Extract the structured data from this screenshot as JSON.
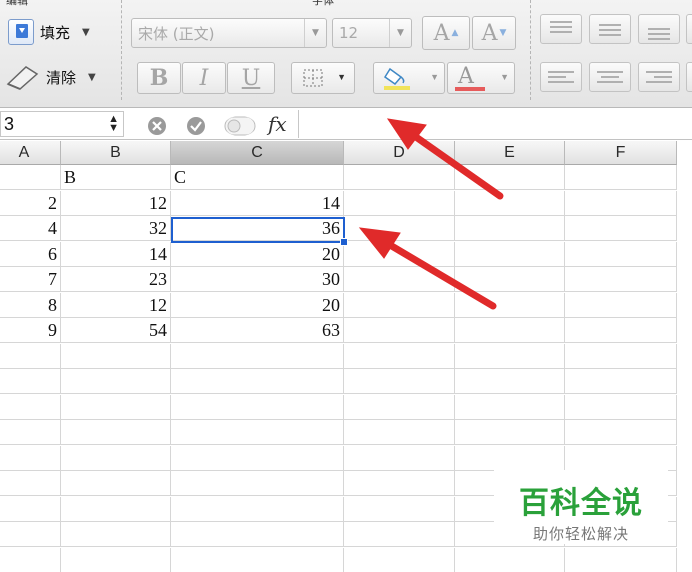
{
  "ribbon": {
    "group_edit_title": "编辑",
    "group_font_title": "字体",
    "fill_label": "填充",
    "clear_label": "清除",
    "font_name": "宋体 (正文)",
    "font_size": "12",
    "increase_font_label": "A",
    "decrease_font_label": "A",
    "bold_label": "B",
    "italic_label": "I",
    "underline_label": "U",
    "font_color_label": "A",
    "fill_color_hex": "#f1e35a",
    "font_color_hex": "#e65b5b"
  },
  "formula_bar": {
    "name_box": "3",
    "fx_label": "fx",
    "formula": ""
  },
  "grid": {
    "columns": [
      "A",
      "B",
      "C",
      "D",
      "E",
      "F"
    ],
    "selected_column": "C",
    "rows": [
      [
        "",
        "B",
        "C",
        "",
        "",
        ""
      ],
      [
        "2",
        "12",
        "14",
        "",
        "",
        ""
      ],
      [
        "4",
        "32",
        "36",
        "",
        "",
        ""
      ],
      [
        "6",
        "14",
        "20",
        "",
        "",
        ""
      ],
      [
        "7",
        "23",
        "30",
        "",
        "",
        ""
      ],
      [
        "8",
        "12",
        "20",
        "",
        "",
        ""
      ],
      [
        "9",
        "54",
        "63",
        "",
        "",
        ""
      ]
    ],
    "active_cell": "C4"
  },
  "annotations": {
    "arrow_color": "#e02a2a"
  },
  "watermark": {
    "title": "百科全说",
    "subtitle": "助你轻松解决"
  }
}
